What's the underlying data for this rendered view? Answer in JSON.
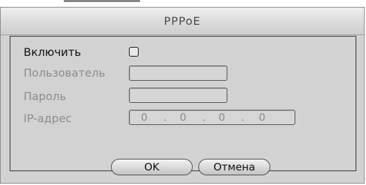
{
  "dialog": {
    "title": "PPPoE"
  },
  "form": {
    "enable_label": "Включить",
    "enable_checked": false,
    "user_label": "Пользователь",
    "user_value": "",
    "password_label": "Пароль",
    "password_value": "",
    "ip_label": "IP-адрес",
    "ip_octets": [
      "0",
      "0",
      "0",
      "0"
    ],
    "ip_separator": "."
  },
  "buttons": {
    "ok_label": "OK",
    "cancel_label": "Отмена"
  }
}
